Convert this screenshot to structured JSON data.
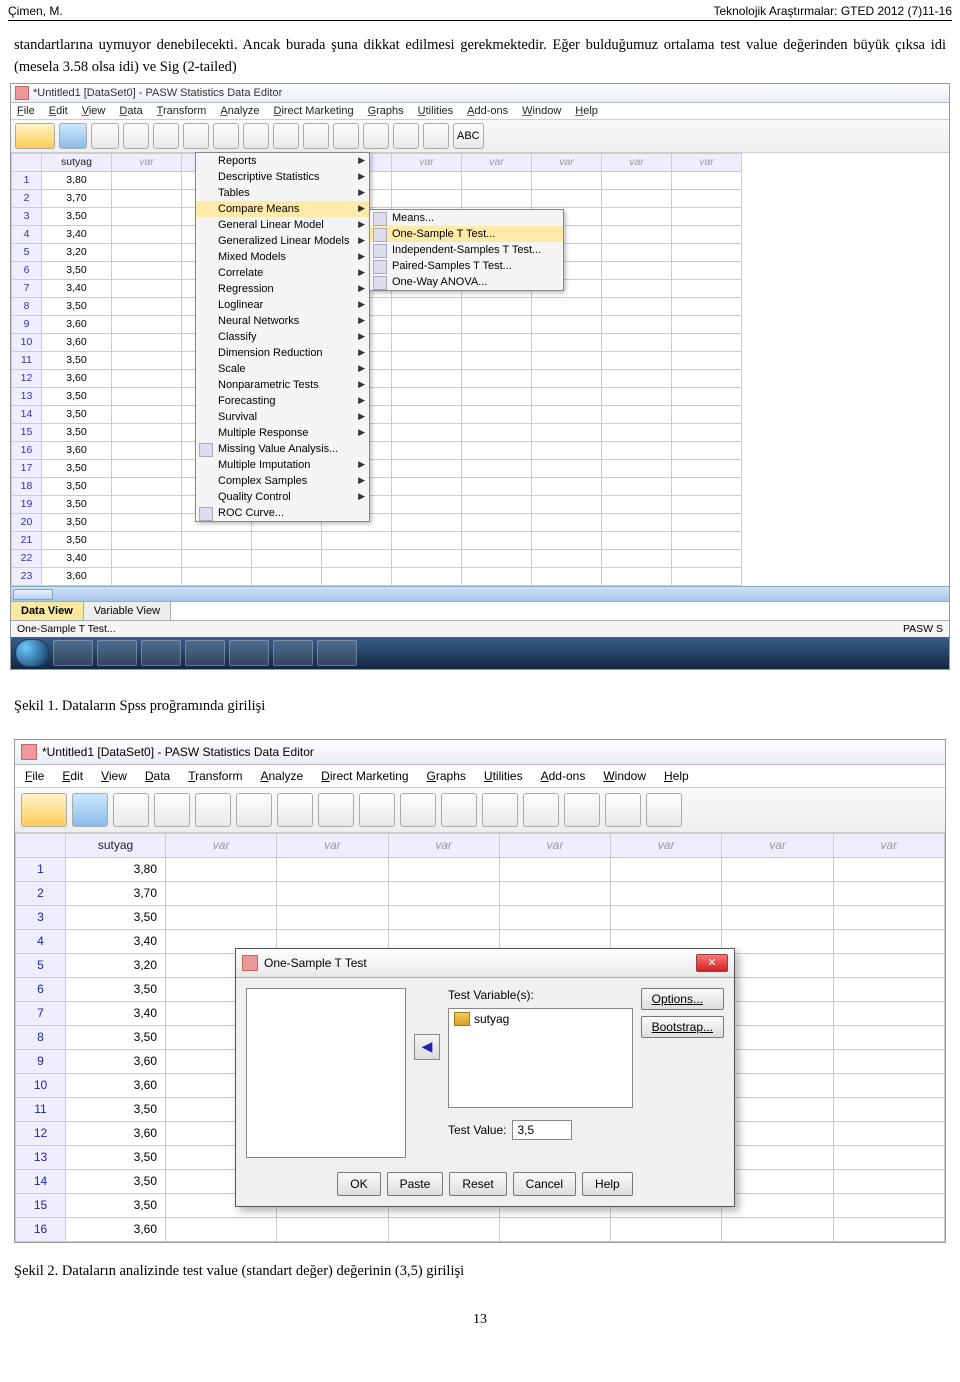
{
  "header": {
    "left": "Çimen, M.",
    "right": "Teknolojik Araştırmalar: GTED 2012 (7)11-16"
  },
  "paragraph": "standartlarına uymuyor denebilecekti. Ancak burada şuna dikkat edilmesi gerekmektedir. Eğer bulduğumuz ortalama test value değerinden büyük çıksa idi (mesela 3.58 olsa idi) ve Sig (2-tailed)",
  "shot1": {
    "title": "*Untitled1 [DataSet0] - PASW Statistics Data Editor",
    "menus": [
      "File",
      "Edit",
      "View",
      "Data",
      "Transform",
      "Analyze",
      "Direct Marketing",
      "Graphs",
      "Utilities",
      "Add-ons",
      "Window",
      "Help"
    ],
    "analyze_menu": [
      {
        "label": "Reports",
        "sub": true
      },
      {
        "label": "Descriptive Statistics",
        "sub": true
      },
      {
        "label": "Tables",
        "sub": true
      },
      {
        "label": "Compare Means",
        "sub": true,
        "hi": true
      },
      {
        "label": "General Linear Model",
        "sub": true
      },
      {
        "label": "Generalized Linear Models",
        "sub": true
      },
      {
        "label": "Mixed Models",
        "sub": true
      },
      {
        "label": "Correlate",
        "sub": true
      },
      {
        "label": "Regression",
        "sub": true
      },
      {
        "label": "Loglinear",
        "sub": true
      },
      {
        "label": "Neural Networks",
        "sub": true
      },
      {
        "label": "Classify",
        "sub": true
      },
      {
        "label": "Dimension Reduction",
        "sub": true
      },
      {
        "label": "Scale",
        "sub": true
      },
      {
        "label": "Nonparametric Tests",
        "sub": true
      },
      {
        "label": "Forecasting",
        "sub": true
      },
      {
        "label": "Survival",
        "sub": true
      },
      {
        "label": "Multiple Response",
        "sub": true
      },
      {
        "label": "Missing Value Analysis...",
        "sub": false,
        "icon": true
      },
      {
        "label": "Multiple Imputation",
        "sub": true
      },
      {
        "label": "Complex Samples",
        "sub": true
      },
      {
        "label": "Quality Control",
        "sub": true
      },
      {
        "label": "ROC Curve...",
        "sub": false,
        "icon": true
      }
    ],
    "compare_submenu": [
      {
        "label": "Means...",
        "icon": true
      },
      {
        "label": "One-Sample T Test...",
        "icon": true,
        "hi": true
      },
      {
        "label": "Independent-Samples T Test...",
        "icon": true
      },
      {
        "label": "Paired-Samples T Test...",
        "icon": true
      },
      {
        "label": "One-Way ANOVA...",
        "icon": true
      }
    ],
    "col_name": "sutyag",
    "other_cols": [
      "var",
      "var",
      "var",
      "var",
      "var",
      "var",
      "var",
      "var",
      "var"
    ],
    "rows": [
      {
        "n": 1,
        "v": "3,80"
      },
      {
        "n": 2,
        "v": "3,70"
      },
      {
        "n": 3,
        "v": "3,50"
      },
      {
        "n": 4,
        "v": "3,40"
      },
      {
        "n": 5,
        "v": "3,20"
      },
      {
        "n": 6,
        "v": "3,50"
      },
      {
        "n": 7,
        "v": "3,40"
      },
      {
        "n": 8,
        "v": "3,50"
      },
      {
        "n": 9,
        "v": "3,60"
      },
      {
        "n": 10,
        "v": "3,60"
      },
      {
        "n": 11,
        "v": "3,50"
      },
      {
        "n": 12,
        "v": "3,60"
      },
      {
        "n": 13,
        "v": "3,50"
      },
      {
        "n": 14,
        "v": "3,50"
      },
      {
        "n": 15,
        "v": "3,50"
      },
      {
        "n": 16,
        "v": "3,60"
      },
      {
        "n": 17,
        "v": "3,50"
      },
      {
        "n": 18,
        "v": "3,50"
      },
      {
        "n": 19,
        "v": "3,50"
      },
      {
        "n": 20,
        "v": "3,50"
      },
      {
        "n": 21,
        "v": "3,50"
      },
      {
        "n": 22,
        "v": "3,40"
      },
      {
        "n": 23,
        "v": "3,60"
      }
    ],
    "tabs": {
      "data": "Data View",
      "var": "Variable View"
    },
    "status_left": "One-Sample T Test...",
    "status_right": "PASW S"
  },
  "caption1": "Şekil 1. Dataların Spss proğramında girilişi",
  "shot2": {
    "title": "*Untitled1 [DataSet0] - PASW Statistics Data Editor",
    "menus": [
      "File",
      "Edit",
      "View",
      "Data",
      "Transform",
      "Analyze",
      "Direct Marketing",
      "Graphs",
      "Utilities",
      "Add-ons",
      "Window",
      "Help"
    ],
    "col_name": "sutyag",
    "other_cols": [
      "var",
      "var",
      "var",
      "var",
      "var",
      "var",
      "var"
    ],
    "rows": [
      {
        "n": 1,
        "v": "3,80"
      },
      {
        "n": 2,
        "v": "3,70"
      },
      {
        "n": 3,
        "v": "3,50"
      },
      {
        "n": 4,
        "v": "3,40"
      },
      {
        "n": 5,
        "v": "3,20"
      },
      {
        "n": 6,
        "v": "3,50"
      },
      {
        "n": 7,
        "v": "3,40"
      },
      {
        "n": 8,
        "v": "3,50"
      },
      {
        "n": 9,
        "v": "3,60"
      },
      {
        "n": 10,
        "v": "3,60"
      },
      {
        "n": 11,
        "v": "3,50"
      },
      {
        "n": 12,
        "v": "3,60"
      },
      {
        "n": 13,
        "v": "3,50"
      },
      {
        "n": 14,
        "v": "3,50"
      },
      {
        "n": 15,
        "v": "3,50"
      },
      {
        "n": 16,
        "v": "3,60"
      }
    ],
    "dialog": {
      "title": "One-Sample T Test",
      "tv_label": "Test Variable(s):",
      "tv_item": "sutyag",
      "test_value_label": "Test Value:",
      "test_value": "3,5",
      "side": {
        "options": "Options...",
        "bootstrap": "Bootstrap..."
      },
      "buttons": [
        "OK",
        "Paste",
        "Reset",
        "Cancel",
        "Help"
      ]
    }
  },
  "caption2": "Şekil 2. Dataların analizinde test value (standart değer) değerinin (3,5) girilişi",
  "page_no": "13"
}
